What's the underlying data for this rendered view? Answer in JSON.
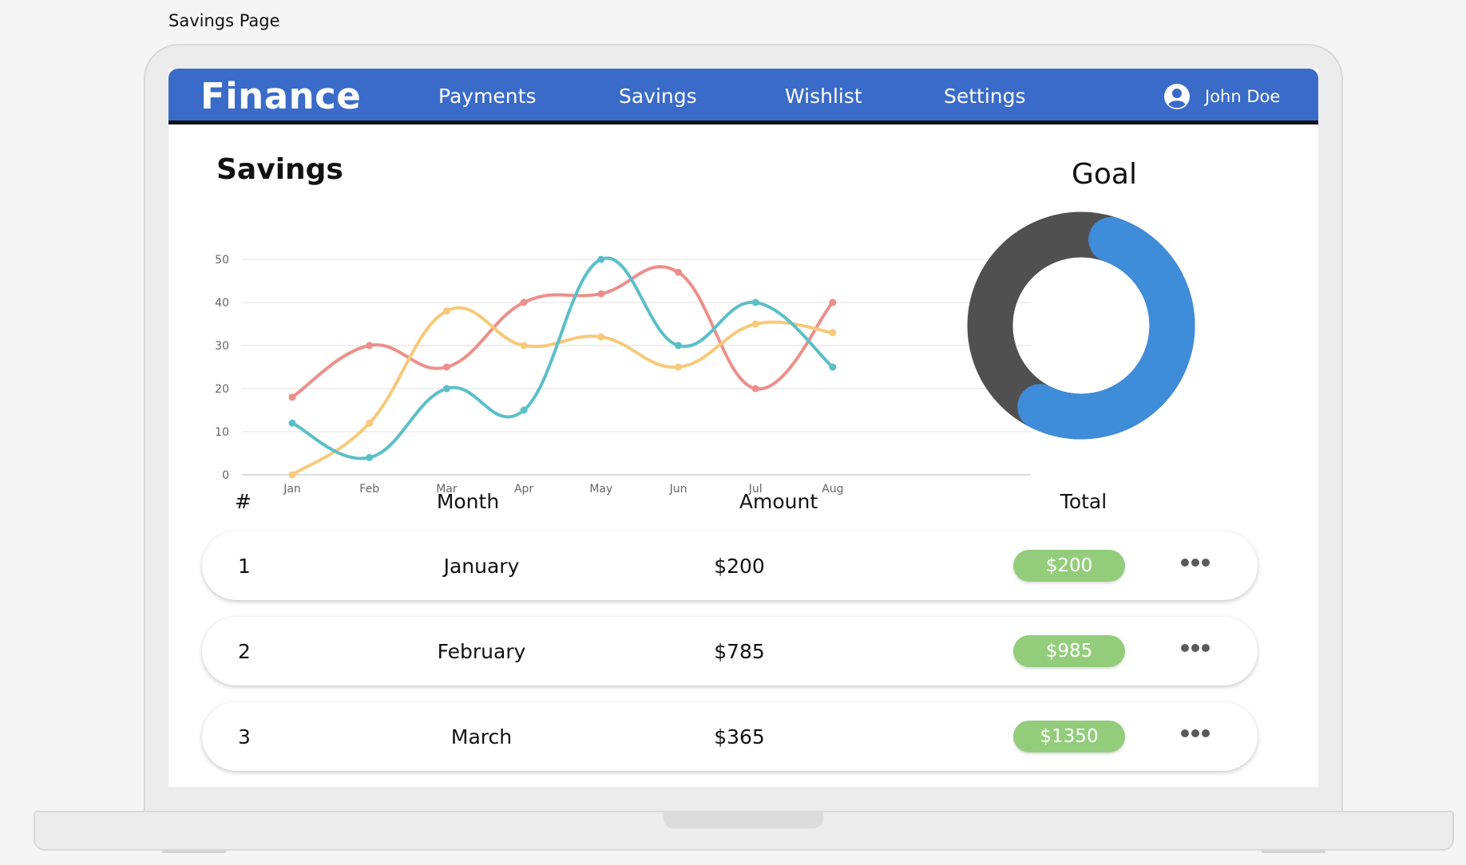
{
  "page_label": "Savings Page",
  "nav": {
    "brand": "Finance",
    "items": [
      "Payments",
      "Savings",
      "Wishlist",
      "Settings"
    ],
    "user_name": "John Doe",
    "background": "#3a6bc8"
  },
  "savings": {
    "title": "Savings"
  },
  "goal": {
    "title": "Goal",
    "progress_fraction": 0.6,
    "progress_color": "#3f8cd9",
    "remaining_color": "#505050"
  },
  "chart_data": {
    "type": "line",
    "title": "Savings",
    "categories": [
      "Jan",
      "Feb",
      "Mar",
      "Apr",
      "May",
      "Jun",
      "Jul",
      "Aug"
    ],
    "ylim": [
      0,
      50
    ],
    "yticks": [
      0,
      10,
      20,
      30,
      40,
      50
    ],
    "grid": true,
    "series": [
      {
        "color": "#ec8f8b",
        "values": [
          18,
          30,
          25,
          40,
          42,
          47,
          20,
          40
        ]
      },
      {
        "color": "#f7c97a",
        "values": [
          0,
          12,
          38,
          30,
          32,
          25,
          35,
          33
        ]
      },
      {
        "color": "#5bbfc8",
        "values": [
          12,
          4,
          20,
          15,
          50,
          30,
          40,
          25
        ]
      }
    ]
  },
  "table": {
    "headers": {
      "num": "#",
      "month": "Month",
      "amount": "Amount",
      "total": "Total"
    },
    "rows": [
      {
        "num": "1",
        "month": "January",
        "amount": "$200",
        "total": "$200"
      },
      {
        "num": "2",
        "month": "February",
        "amount": "$785",
        "total": "$985"
      },
      {
        "num": "3",
        "month": "March",
        "amount": "$365",
        "total": "$1350"
      }
    ],
    "total_badge_color": "#93cd7b"
  },
  "icons": {
    "user": "user-circle-icon",
    "row_menu": "more-horizontal-icon"
  }
}
